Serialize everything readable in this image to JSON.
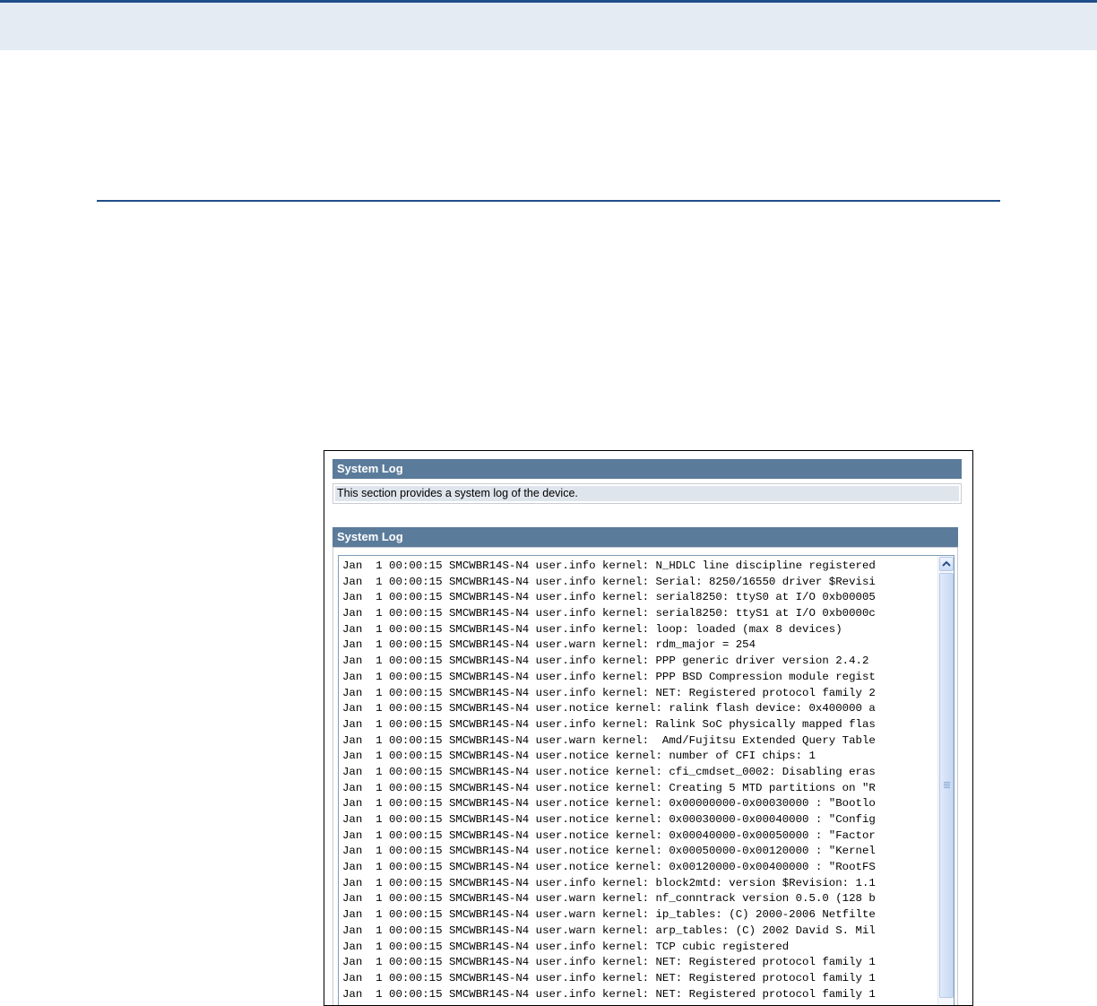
{
  "panels": {
    "intro_title": "System Log",
    "description": "This section provides a system log of the device.",
    "log_title": "System Log"
  },
  "colors": {
    "doc_rule": "#1f4e89",
    "top_band": "#e5ebf2",
    "panel_header": "#5b7b9b",
    "description_fill": "#dfe5ec"
  },
  "icons": {
    "scroll_up": "chevron-up-icon",
    "thumb_grip": "grip-lines-icon"
  },
  "log": {
    "lines": [
      "Jan  1 00:00:15 SMCWBR14S-N4 user.info kernel: N_HDLC line discipline registered",
      "Jan  1 00:00:15 SMCWBR14S-N4 user.info kernel: Serial: 8250/16550 driver $Revisi",
      "Jan  1 00:00:15 SMCWBR14S-N4 user.info kernel: serial8250: ttyS0 at I/O 0xb00005",
      "Jan  1 00:00:15 SMCWBR14S-N4 user.info kernel: serial8250: ttyS1 at I/O 0xb0000c",
      "Jan  1 00:00:15 SMCWBR14S-N4 user.info kernel: loop: loaded (max 8 devices)",
      "Jan  1 00:00:15 SMCWBR14S-N4 user.warn kernel: rdm_major = 254",
      "Jan  1 00:00:15 SMCWBR14S-N4 user.info kernel: PPP generic driver version 2.4.2",
      "Jan  1 00:00:15 SMCWBR14S-N4 user.info kernel: PPP BSD Compression module regist",
      "Jan  1 00:00:15 SMCWBR14S-N4 user.info kernel: NET: Registered protocol family 2",
      "Jan  1 00:00:15 SMCWBR14S-N4 user.notice kernel: ralink flash device: 0x400000 a",
      "Jan  1 00:00:15 SMCWBR14S-N4 user.info kernel: Ralink SoC physically mapped flas",
      "Jan  1 00:00:15 SMCWBR14S-N4 user.warn kernel:  Amd/Fujitsu Extended Query Table",
      "Jan  1 00:00:15 SMCWBR14S-N4 user.notice kernel: number of CFI chips: 1",
      "Jan  1 00:00:15 SMCWBR14S-N4 user.notice kernel: cfi_cmdset_0002: Disabling eras",
      "Jan  1 00:00:15 SMCWBR14S-N4 user.notice kernel: Creating 5 MTD partitions on \"R",
      "Jan  1 00:00:15 SMCWBR14S-N4 user.notice kernel: 0x00000000-0x00030000 : \"Bootlo",
      "Jan  1 00:00:15 SMCWBR14S-N4 user.notice kernel: 0x00030000-0x00040000 : \"Config",
      "Jan  1 00:00:15 SMCWBR14S-N4 user.notice kernel: 0x00040000-0x00050000 : \"Factor",
      "Jan  1 00:00:15 SMCWBR14S-N4 user.notice kernel: 0x00050000-0x00120000 : \"Kernel",
      "Jan  1 00:00:15 SMCWBR14S-N4 user.notice kernel: 0x00120000-0x00400000 : \"RootFS",
      "Jan  1 00:00:15 SMCWBR14S-N4 user.info kernel: block2mtd: version $Revision: 1.1",
      "Jan  1 00:00:15 SMCWBR14S-N4 user.warn kernel: nf_conntrack version 0.5.0 (128 b",
      "Jan  1 00:00:15 SMCWBR14S-N4 user.warn kernel: ip_tables: (C) 2000-2006 Netfilte",
      "Jan  1 00:00:15 SMCWBR14S-N4 user.warn kernel: arp_tables: (C) 2002 David S. Mil",
      "Jan  1 00:00:15 SMCWBR14S-N4 user.info kernel: TCP cubic registered",
      "Jan  1 00:00:15 SMCWBR14S-N4 user.info kernel: NET: Registered protocol family 1",
      "Jan  1 00:00:15 SMCWBR14S-N4 user.info kernel: NET: Registered protocol family 1",
      "Jan  1 00:00:15 SMCWBR14S-N4 user.info kernel: NET: Registered protocol family 1"
    ]
  }
}
